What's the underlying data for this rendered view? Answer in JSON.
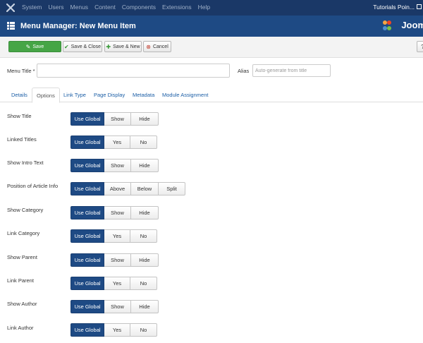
{
  "topnav": {
    "menu": [
      "System",
      "Users",
      "Menus",
      "Content",
      "Components",
      "Extensions",
      "Help"
    ],
    "site": "Tutorials Poin..."
  },
  "header": {
    "title": "Menu Manager: New Menu Item",
    "brand": "Joom"
  },
  "toolbar": {
    "save": "Save",
    "save_close": "Save & Close",
    "save_new": "Save & New",
    "cancel": "Cancel"
  },
  "form": {
    "menu_title_label": "Menu Title *",
    "menu_title_value": "",
    "alias_label": "Alias",
    "alias_placeholder": "Auto-generate from title"
  },
  "tabs": [
    "Details",
    "Options",
    "Link Type",
    "Page Display",
    "Metadata",
    "Module Assignment"
  ],
  "active_tab": "Options",
  "options": [
    {
      "label": "Show Title",
      "choices": [
        "Use Global",
        "Show",
        "Hide"
      ],
      "selected": "Use Global"
    },
    {
      "label": "Linked Titles",
      "choices": [
        "Use Global",
        "Yes",
        "No"
      ],
      "selected": "Use Global"
    },
    {
      "label": "Show Intro Text",
      "choices": [
        "Use Global",
        "Show",
        "Hide"
      ],
      "selected": "Use Global"
    },
    {
      "label": "Position of Article Info",
      "choices": [
        "Use Global",
        "Above",
        "Below",
        "Split"
      ],
      "selected": "Use Global"
    },
    {
      "label": "Show Category",
      "choices": [
        "Use Global",
        "Show",
        "Hide"
      ],
      "selected": "Use Global"
    },
    {
      "label": "Link Category",
      "choices": [
        "Use Global",
        "Yes",
        "No"
      ],
      "selected": "Use Global"
    },
    {
      "label": "Show Parent",
      "choices": [
        "Use Global",
        "Show",
        "Hide"
      ],
      "selected": "Use Global"
    },
    {
      "label": "Link Parent",
      "choices": [
        "Use Global",
        "Yes",
        "No"
      ],
      "selected": "Use Global"
    },
    {
      "label": "Show Author",
      "choices": [
        "Use Global",
        "Show",
        "Hide"
      ],
      "selected": "Use Global"
    },
    {
      "label": "Link Author",
      "choices": [
        "Use Global",
        "Yes",
        "No"
      ],
      "selected": "Use Global"
    }
  ],
  "colors": {
    "topnav_bg": "#1a3867",
    "header_bg": "#1e4a84",
    "save_green": "#46a546",
    "active_segment": "#1e4a84",
    "tab_link": "#1b5ea6"
  }
}
